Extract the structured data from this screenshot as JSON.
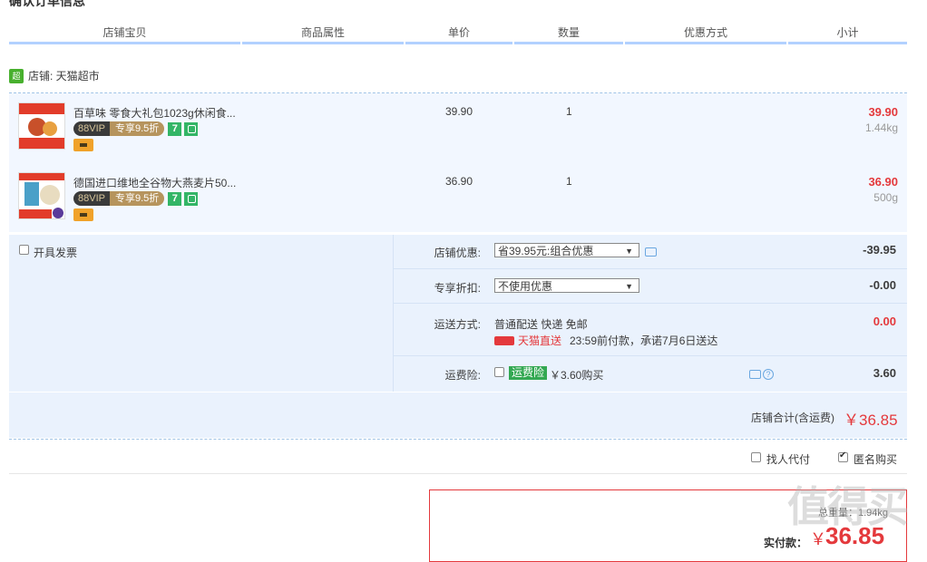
{
  "section_title": "确认订单信息",
  "columns": [
    "店铺宝贝",
    "商品属性",
    "单价",
    "数量",
    "优惠方式",
    "小计"
  ],
  "shop": {
    "icon": "超市",
    "label": "店铺: 天猫超市"
  },
  "items": [
    {
      "title": "百草味 零食大礼包1023g休闲食...",
      "vip_tag": "88VIP",
      "vip_discount": "专享9.5折",
      "tag7": "7",
      "unit_price": "39.90",
      "qty": "1",
      "subtotal": "39.90",
      "weight": "1.44kg"
    },
    {
      "title": "德国进口维地全谷物大燕麦片50...",
      "vip_tag": "88VIP",
      "vip_discount": "专享9.5折",
      "tag7": "7",
      "unit_price": "36.90",
      "qty": "1",
      "subtotal": "36.90",
      "weight": "500g"
    }
  ],
  "invoice_label": "开具发票",
  "options": {
    "shop_discount_label": "店铺优惠:",
    "shop_discount_value": "省39.95元:组合优惠",
    "shop_discount_amount": "-39.95",
    "exclusive_label": "专享折扣:",
    "exclusive_value": "不使用优惠",
    "exclusive_amount": "-0.00",
    "delivery_label": "运送方式:",
    "delivery_value": "普通配送 快递 免邮",
    "tmall_direct": "天猫直送",
    "delivery_promise": "23:59前付款，承诺7月6日送达",
    "delivery_amount": "0.00",
    "insurance_label": "运费险:",
    "insurance_tag": "运费险",
    "insurance_price": "￥3.60购买",
    "insurance_amount": "3.60"
  },
  "shop_total_label": "店铺合计(含运费)",
  "shop_total_value": "￥36.85",
  "proxy_label": "找人代付",
  "anonymous_label": "匿名购买",
  "total_weight_label": "总重量：1.94kg",
  "pay_label": "实付款：",
  "pay_currency": "￥",
  "pay_value": "36.85",
  "watermark": "值得买",
  "colors": {
    "accent_red": "#e4393c",
    "header_line": "#b2d1ff",
    "option_bg": "#eaf2fd",
    "item_bg": "#f2f7ff"
  }
}
